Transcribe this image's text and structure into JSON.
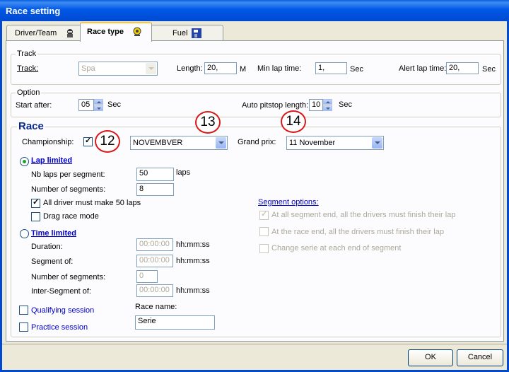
{
  "window": {
    "title": "Race setting"
  },
  "tabs": [
    {
      "label": "Driver/Team",
      "icon": "driver-icon"
    },
    {
      "label": "Race type",
      "icon": "race-type-icon"
    },
    {
      "label": "Fuel",
      "icon": "fuel-pump-icon"
    }
  ],
  "track": {
    "legend": "Track",
    "track_label": "Track:",
    "track_value": "Spa",
    "length_label": "Length:",
    "length_value": "20,",
    "length_unit": "M",
    "min_lap_label": "Min lap time:",
    "min_lap_value": "1,",
    "min_lap_unit": "Sec",
    "alert_lap_label": "Alert lap time:",
    "alert_lap_value": "20,",
    "alert_lap_unit": "Sec"
  },
  "option": {
    "legend": "Option",
    "start_after_label": "Start after:",
    "start_after_value": "05",
    "start_after_unit": "Sec",
    "pitstop_label": "Auto pitstop length:",
    "pitstop_value": "10",
    "pitstop_unit": "Sec"
  },
  "race": {
    "legend": "Race",
    "championship_label": "Championship:",
    "championship_checked": true,
    "championship_value": "NOVEMBVER",
    "grand_prix_label": "Grand prix:",
    "grand_prix_value": "11 November",
    "badges": [
      "12",
      "13",
      "14"
    ],
    "lap_limited": {
      "label": "Lap limited",
      "nb_laps_label": "Nb laps per segment:",
      "nb_laps_value": "50",
      "nb_laps_unit": "laps",
      "segments_label": "Number of segments:",
      "segments_value": "8",
      "all_driver_label": "All driver must make 50 laps",
      "drag_race_label": "Drag race mode"
    },
    "segment_options": {
      "title": "Segment options:",
      "items": [
        "At all segment end, all the drivers must finish their lap",
        "At the race end, all the drivers must finish their lap",
        "Change serie at each end of segment"
      ]
    },
    "time_limited": {
      "label": "Time limited",
      "duration_label": "Duration:",
      "duration_value": "00:00:00",
      "segment_of_label": "Segment of:",
      "segment_of_value": "00:00:00",
      "segments_label": "Number of segments:",
      "segments_value": "0",
      "inter_segment_label": "Inter-Segment of:",
      "inter_segment_value": "00:00:00",
      "unit": "hh:mm:ss"
    },
    "qualifying_label": "Qualifying session",
    "practice_label": "Practice session",
    "race_name_label": "Race name:",
    "race_name_value": "Serie"
  },
  "buttons": {
    "ok": "OK",
    "cancel": "Cancel"
  }
}
